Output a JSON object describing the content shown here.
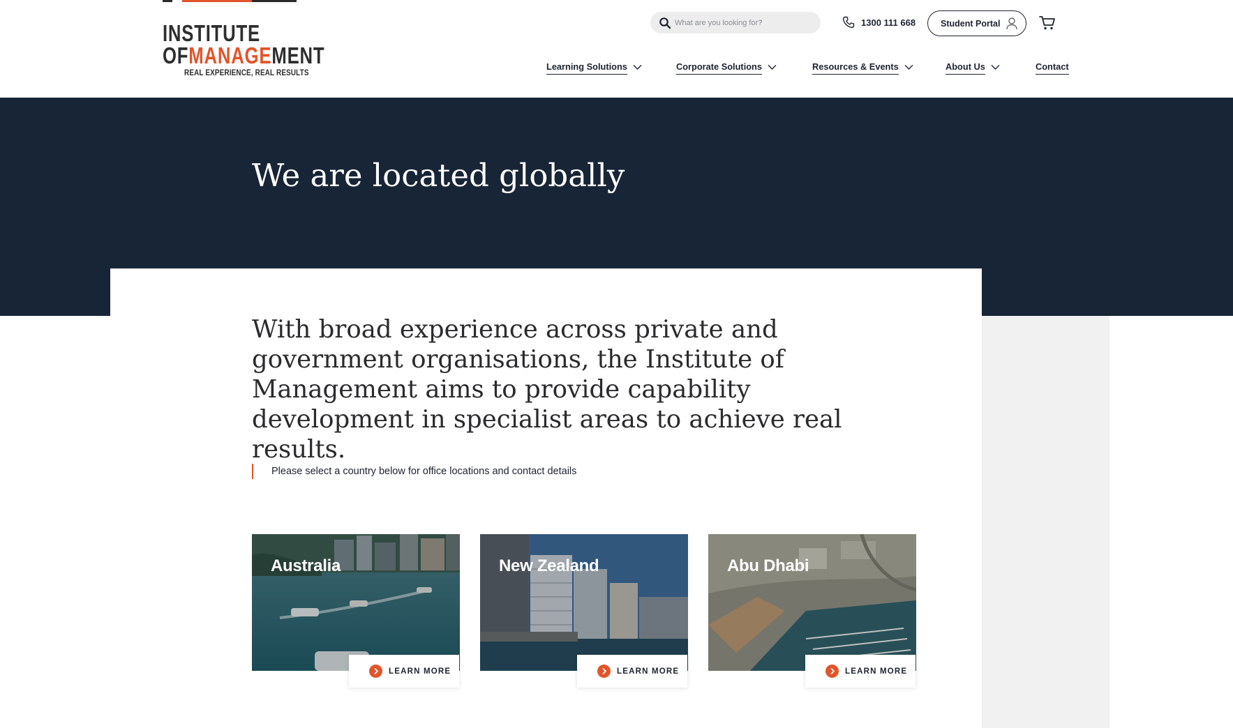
{
  "header": {
    "logo": {
      "line1": "INSTITUTE",
      "line2_prefix": "OF",
      "line2_accent": "MANAGE",
      "line2_suffix": "MENT",
      "tagline": "REAL EXPERIENCE, REAL RESULTS"
    },
    "search_placeholder": "What are you looking for?",
    "phone": "1300 111 668",
    "student_portal": "Student Portal",
    "nav": [
      {
        "label": "Learning Solutions",
        "has_dropdown": true
      },
      {
        "label": "Corporate Solutions",
        "has_dropdown": true
      },
      {
        "label": "Resources & Events",
        "has_dropdown": true
      },
      {
        "label": "About Us",
        "has_dropdown": true
      },
      {
        "label": "Contact",
        "has_dropdown": false
      }
    ]
  },
  "hero": {
    "title": "We are located globally"
  },
  "main": {
    "intro": "With broad experience across private and government organisations, the Institute of Management aims to provide capability development in specialist areas to achieve real results.",
    "note": "Please select a country below for office locations and contact details",
    "locations": [
      {
        "name": "Australia",
        "cta": "LEARN MORE"
      },
      {
        "name": "New Zealand",
        "cta": "LEARN MORE"
      },
      {
        "name": "Abu Dhabi",
        "cta": "LEARN MORE"
      }
    ]
  },
  "colors": {
    "accent": "#e2542a",
    "navy": "#182536",
    "text": "#1d2330",
    "grey_panel": "#f1f1f2"
  },
  "icons": [
    "search-icon",
    "phone-icon",
    "user-icon",
    "cart-icon",
    "chevron-down-icon",
    "chevron-right-circle-icon"
  ]
}
